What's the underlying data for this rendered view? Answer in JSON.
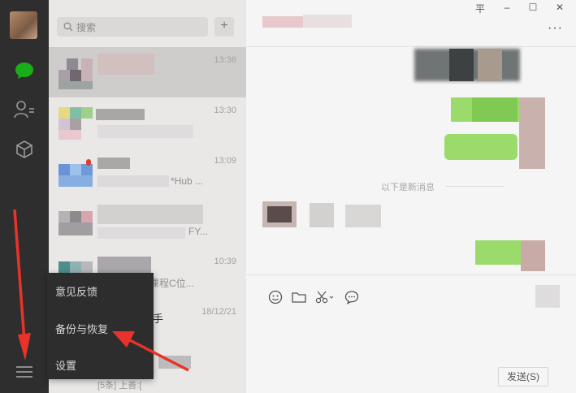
{
  "window": {
    "controls": {
      "pin": "平",
      "minimize": "–",
      "maximize": "☐",
      "close": "✕"
    },
    "more": "···"
  },
  "sidebar": {
    "icons": [
      "chat-icon",
      "contacts-icon",
      "favorites-icon",
      "menu-icon"
    ],
    "accent": "#1aad19"
  },
  "search": {
    "placeholder": "搜索",
    "add_label": "+"
  },
  "chats": [
    {
      "time": "13:38",
      "preview": ""
    },
    {
      "time": "13:30",
      "preview": ""
    },
    {
      "time": "13:09",
      "preview": "*Hub ..."
    },
    {
      "time": "",
      "preview": "FY..."
    },
    {
      "time": "10:39",
      "preview": "课程C位..."
    },
    {
      "time": "18/12/21",
      "preview": "手"
    },
    {
      "time": "",
      "preview": "[5条] 上善:["
    }
  ],
  "conversation": {
    "new_messages_label": "以下是新消息"
  },
  "toolbar": {
    "tools": [
      "emoji-icon",
      "folder-icon",
      "scissors-icon",
      "chat-bubble-icon"
    ],
    "send_label": "发送(S)"
  },
  "popup_menu": {
    "items": [
      "意见反馈",
      "备份与恢复",
      "设置"
    ]
  },
  "annotation_color": "#e8332a"
}
